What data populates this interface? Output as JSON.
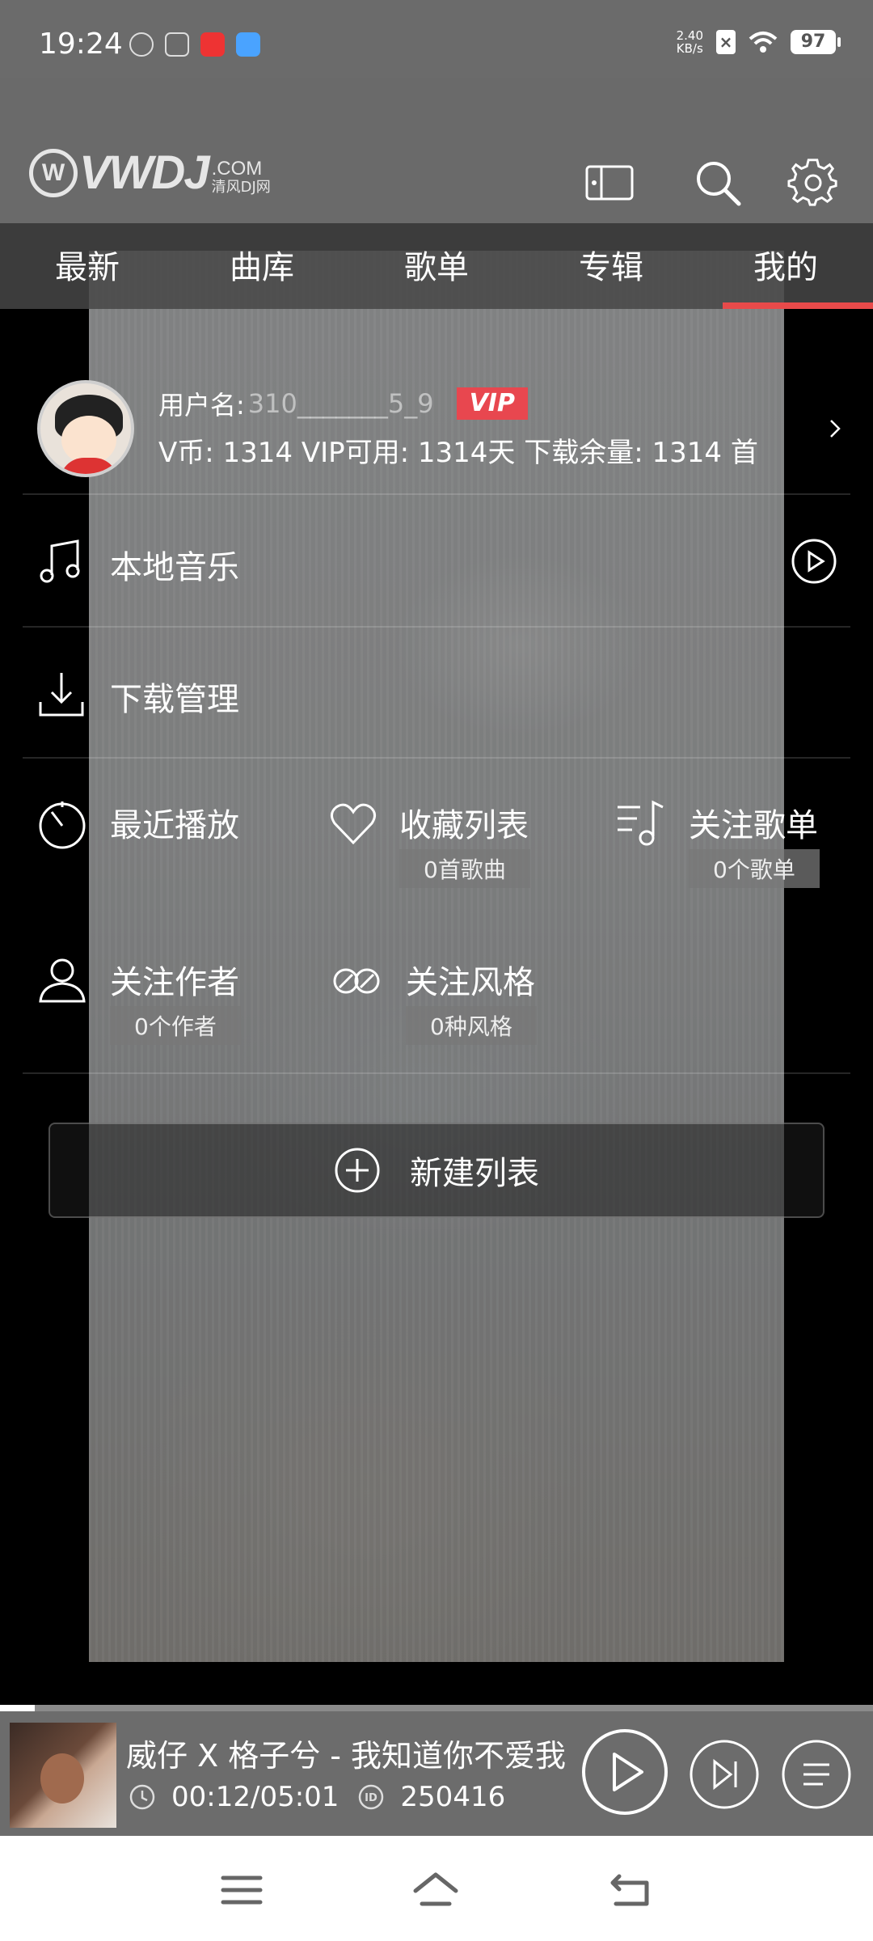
{
  "status_bar": {
    "time": "19:24",
    "net_speed_value": "2.40",
    "net_speed_unit": "KB/s",
    "battery": "97",
    "icons": [
      "vpn-icon",
      "notes-icon",
      "app-notification-icon",
      "browser-icon",
      "no-sim-icon",
      "wifi-icon",
      "battery-icon"
    ]
  },
  "header": {
    "logo_text": "VWDJ",
    "logo_mark": "W",
    "logo_domain": ".COM",
    "logo_cn": "清风DJ网",
    "icons": [
      "screen-icon",
      "search-icon",
      "gear-icon"
    ]
  },
  "tabs": [
    {
      "label": "最新",
      "active": false
    },
    {
      "label": "曲库",
      "active": false
    },
    {
      "label": "歌单",
      "active": false
    },
    {
      "label": "专辑",
      "active": false
    },
    {
      "label": "我的",
      "active": true
    }
  ],
  "profile": {
    "username_label": "用户名:",
    "username_value": "310_______5_9",
    "vip_badge": "VIP",
    "stats": "V币: 1314   VIP可用: 1314天  下载余量: 1314 首"
  },
  "menu": {
    "local_music": "本地音乐",
    "download_manager": "下载管理",
    "recent_play": "最近播放",
    "favorites": {
      "label": "收藏列表",
      "sub": "0首歌曲"
    },
    "followed_playlists": {
      "label": "关注歌单",
      "sub": "0个歌单"
    },
    "followed_authors": {
      "label": "关注作者",
      "sub": "0个作者"
    },
    "followed_styles": {
      "label": "关注风格",
      "sub": "0种风格"
    },
    "new_list": "新建列表"
  },
  "player": {
    "title": "威仔 X 格子兮 - 我知道你不爱我",
    "time": "00:12/05:01",
    "id": "250416",
    "progress": 0.04
  },
  "colors": {
    "accent": "#e84a4a",
    "header_bg": "#6a6a6a",
    "player_bg": "#6c6c6c"
  }
}
